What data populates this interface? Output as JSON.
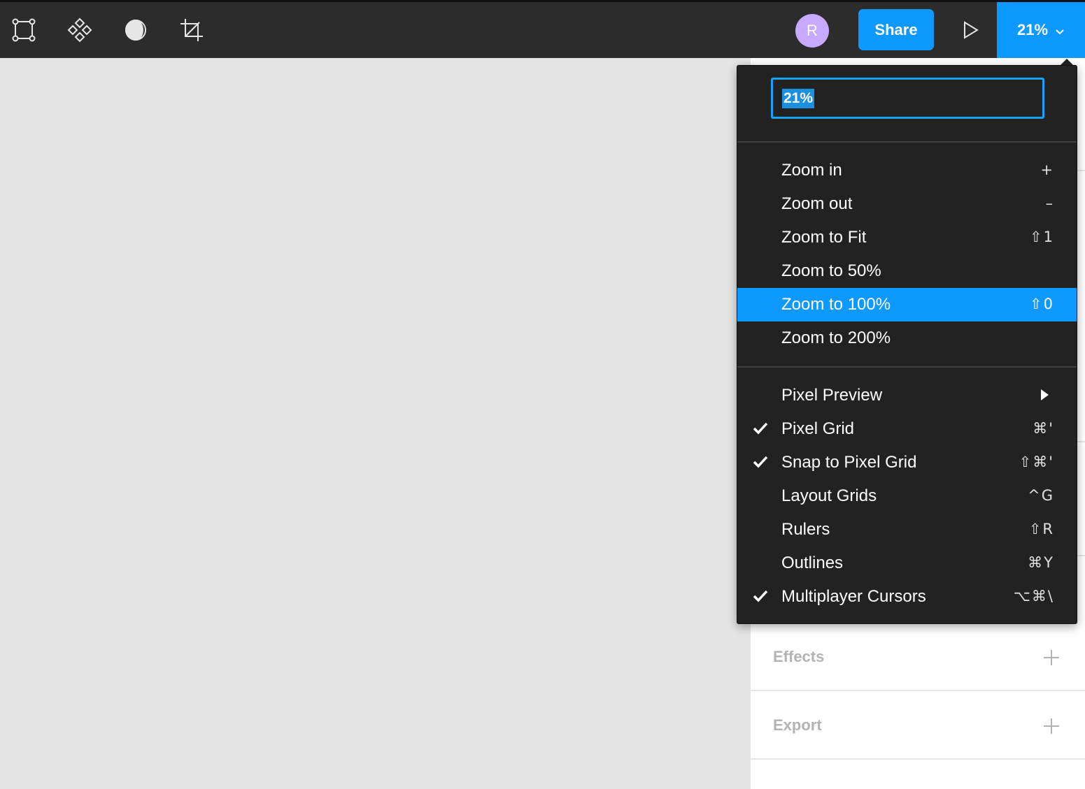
{
  "toolbar": {
    "tools": [
      {
        "icon": "frame-icon"
      },
      {
        "icon": "components-icon"
      },
      {
        "icon": "contrast-icon"
      },
      {
        "icon": "crop-icon"
      }
    ],
    "avatar_initial": "R",
    "share_label": "Share",
    "zoom_label": "21%"
  },
  "zoom_menu": {
    "input_value": "21%",
    "zoom_items": [
      {
        "label": "Zoom in",
        "shortcut": "+"
      },
      {
        "label": "Zoom out",
        "shortcut": "–"
      },
      {
        "label": "Zoom to Fit",
        "shortcut": "⇧1"
      },
      {
        "label": "Zoom to 50%",
        "shortcut": ""
      },
      {
        "label": "Zoom to 100%",
        "shortcut": "⇧0",
        "highlighted": true
      },
      {
        "label": "Zoom to 200%",
        "shortcut": ""
      }
    ],
    "view_items": [
      {
        "label": "Pixel Preview",
        "shortcut": "",
        "submenu": true,
        "checked": false
      },
      {
        "label": "Pixel Grid",
        "shortcut": "⌘'",
        "checked": true
      },
      {
        "label": "Snap to Pixel Grid",
        "shortcut": "⇧⌘'",
        "checked": true
      },
      {
        "label": "Layout Grids",
        "shortcut": "^G",
        "checked": false
      },
      {
        "label": "Rulers",
        "shortcut": "⇧R",
        "checked": false
      },
      {
        "label": "Outlines",
        "shortcut": "⌘Y",
        "checked": false
      },
      {
        "label": "Multiplayer Cursors",
        "shortcut": "⌥⌘\\",
        "checked": true
      }
    ]
  },
  "panel": {
    "effects_label": "Effects",
    "export_label": "Export"
  },
  "colors": {
    "toolbar_bg": "#2c2c2c",
    "accent": "#0d99ff",
    "menu_bg": "#222222",
    "canvas_bg": "#e5e5e5",
    "avatar": "#c7a9ff"
  }
}
